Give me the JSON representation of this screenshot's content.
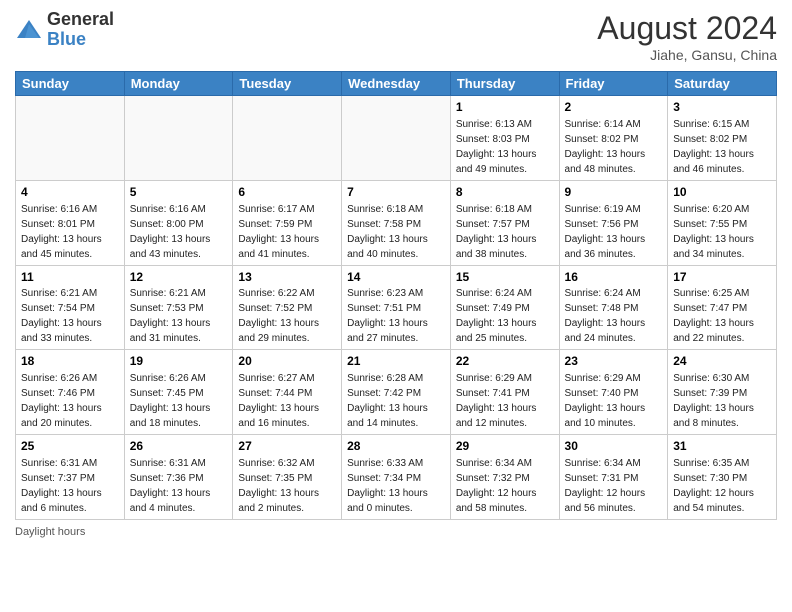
{
  "logo": {
    "general": "General",
    "blue": "Blue"
  },
  "title": {
    "month_year": "August 2024",
    "location": "Jiahe, Gansu, China"
  },
  "days_of_week": [
    "Sunday",
    "Monday",
    "Tuesday",
    "Wednesday",
    "Thursday",
    "Friday",
    "Saturday"
  ],
  "weeks": [
    [
      {
        "day": "",
        "info": ""
      },
      {
        "day": "",
        "info": ""
      },
      {
        "day": "",
        "info": ""
      },
      {
        "day": "",
        "info": ""
      },
      {
        "day": "1",
        "info": "Sunrise: 6:13 AM\nSunset: 8:03 PM\nDaylight: 13 hours and 49 minutes."
      },
      {
        "day": "2",
        "info": "Sunrise: 6:14 AM\nSunset: 8:02 PM\nDaylight: 13 hours and 48 minutes."
      },
      {
        "day": "3",
        "info": "Sunrise: 6:15 AM\nSunset: 8:02 PM\nDaylight: 13 hours and 46 minutes."
      }
    ],
    [
      {
        "day": "4",
        "info": "Sunrise: 6:16 AM\nSunset: 8:01 PM\nDaylight: 13 hours and 45 minutes."
      },
      {
        "day": "5",
        "info": "Sunrise: 6:16 AM\nSunset: 8:00 PM\nDaylight: 13 hours and 43 minutes."
      },
      {
        "day": "6",
        "info": "Sunrise: 6:17 AM\nSunset: 7:59 PM\nDaylight: 13 hours and 41 minutes."
      },
      {
        "day": "7",
        "info": "Sunrise: 6:18 AM\nSunset: 7:58 PM\nDaylight: 13 hours and 40 minutes."
      },
      {
        "day": "8",
        "info": "Sunrise: 6:18 AM\nSunset: 7:57 PM\nDaylight: 13 hours and 38 minutes."
      },
      {
        "day": "9",
        "info": "Sunrise: 6:19 AM\nSunset: 7:56 PM\nDaylight: 13 hours and 36 minutes."
      },
      {
        "day": "10",
        "info": "Sunrise: 6:20 AM\nSunset: 7:55 PM\nDaylight: 13 hours and 34 minutes."
      }
    ],
    [
      {
        "day": "11",
        "info": "Sunrise: 6:21 AM\nSunset: 7:54 PM\nDaylight: 13 hours and 33 minutes."
      },
      {
        "day": "12",
        "info": "Sunrise: 6:21 AM\nSunset: 7:53 PM\nDaylight: 13 hours and 31 minutes."
      },
      {
        "day": "13",
        "info": "Sunrise: 6:22 AM\nSunset: 7:52 PM\nDaylight: 13 hours and 29 minutes."
      },
      {
        "day": "14",
        "info": "Sunrise: 6:23 AM\nSunset: 7:51 PM\nDaylight: 13 hours and 27 minutes."
      },
      {
        "day": "15",
        "info": "Sunrise: 6:24 AM\nSunset: 7:49 PM\nDaylight: 13 hours and 25 minutes."
      },
      {
        "day": "16",
        "info": "Sunrise: 6:24 AM\nSunset: 7:48 PM\nDaylight: 13 hours and 24 minutes."
      },
      {
        "day": "17",
        "info": "Sunrise: 6:25 AM\nSunset: 7:47 PM\nDaylight: 13 hours and 22 minutes."
      }
    ],
    [
      {
        "day": "18",
        "info": "Sunrise: 6:26 AM\nSunset: 7:46 PM\nDaylight: 13 hours and 20 minutes."
      },
      {
        "day": "19",
        "info": "Sunrise: 6:26 AM\nSunset: 7:45 PM\nDaylight: 13 hours and 18 minutes."
      },
      {
        "day": "20",
        "info": "Sunrise: 6:27 AM\nSunset: 7:44 PM\nDaylight: 13 hours and 16 minutes."
      },
      {
        "day": "21",
        "info": "Sunrise: 6:28 AM\nSunset: 7:42 PM\nDaylight: 13 hours and 14 minutes."
      },
      {
        "day": "22",
        "info": "Sunrise: 6:29 AM\nSunset: 7:41 PM\nDaylight: 13 hours and 12 minutes."
      },
      {
        "day": "23",
        "info": "Sunrise: 6:29 AM\nSunset: 7:40 PM\nDaylight: 13 hours and 10 minutes."
      },
      {
        "day": "24",
        "info": "Sunrise: 6:30 AM\nSunset: 7:39 PM\nDaylight: 13 hours and 8 minutes."
      }
    ],
    [
      {
        "day": "25",
        "info": "Sunrise: 6:31 AM\nSunset: 7:37 PM\nDaylight: 13 hours and 6 minutes."
      },
      {
        "day": "26",
        "info": "Sunrise: 6:31 AM\nSunset: 7:36 PM\nDaylight: 13 hours and 4 minutes."
      },
      {
        "day": "27",
        "info": "Sunrise: 6:32 AM\nSunset: 7:35 PM\nDaylight: 13 hours and 2 minutes."
      },
      {
        "day": "28",
        "info": "Sunrise: 6:33 AM\nSunset: 7:34 PM\nDaylight: 13 hours and 0 minutes."
      },
      {
        "day": "29",
        "info": "Sunrise: 6:34 AM\nSunset: 7:32 PM\nDaylight: 12 hours and 58 minutes."
      },
      {
        "day": "30",
        "info": "Sunrise: 6:34 AM\nSunset: 7:31 PM\nDaylight: 12 hours and 56 minutes."
      },
      {
        "day": "31",
        "info": "Sunrise: 6:35 AM\nSunset: 7:30 PM\nDaylight: 12 hours and 54 minutes."
      }
    ]
  ],
  "footer": {
    "daylight_label": "Daylight hours"
  }
}
